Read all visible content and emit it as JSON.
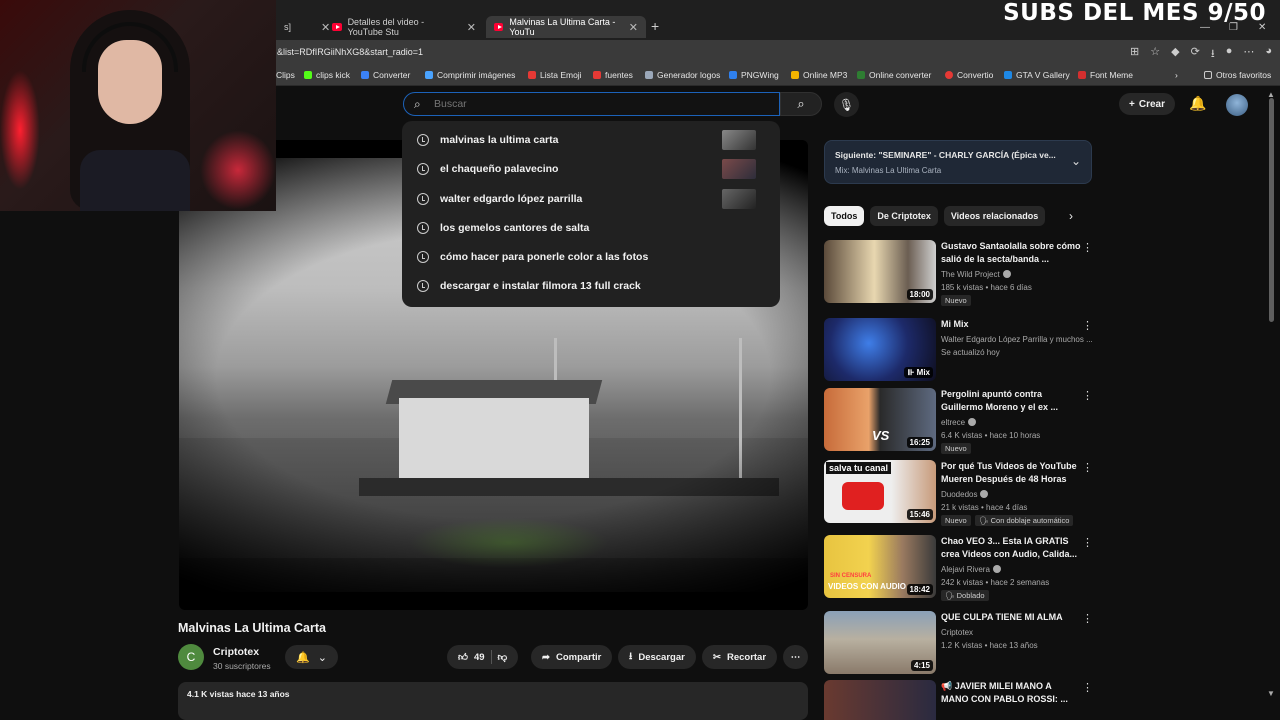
{
  "overlay": {
    "subs_text": "SUBS DEL MES 9/50"
  },
  "browser": {
    "tabs": [
      {
        "label": "s]",
        "active": false
      },
      {
        "label": "Detalles del video - YouTube Stu",
        "active": false
      },
      {
        "label": "Malvinas La Ultima Carta - YouTu",
        "active": true
      }
    ],
    "url": "&list=RDfIRGiiNhXG8&start_radio=1",
    "bookmarks": [
      {
        "label": "Clips",
        "color": "#888888"
      },
      {
        "label": "clips kick",
        "color": "#53fc18"
      },
      {
        "label": "Converter",
        "color": "#3b82f6"
      },
      {
        "label": "Comprimir imágenes",
        "color": "#4aa3ff"
      },
      {
        "label": "Lista Emoji",
        "color": "#e53935"
      },
      {
        "label": "fuentes",
        "color": "#e53935"
      },
      {
        "label": "Generador logos",
        "color": "#9aa7b8"
      },
      {
        "label": "PNGWing",
        "color": "#2f80ed"
      },
      {
        "label": "Online MP3",
        "color": "#f4b400"
      },
      {
        "label": "Online converter",
        "color": "#2e7d32"
      },
      {
        "label": "Convertio",
        "color": "#e53935"
      },
      {
        "label": "GTA V Gallery",
        "color": "#1e88e5"
      },
      {
        "label": "Font Meme",
        "color": "#d32f2f"
      },
      {
        "label": "Otros favoritos",
        "color": "#cccccc"
      }
    ]
  },
  "header": {
    "search_placeholder": "Buscar",
    "create_label": "Crear"
  },
  "suggestions": [
    "malvinas la ultima carta",
    "el chaqueño palavecino",
    "walter edgardo lópez parrilla",
    "los gemelos cantores de salta",
    "cómo hacer para ponerle color a las fotos",
    "descargar e instalar filmora 13 full crack"
  ],
  "video": {
    "title": "Malvinas La Ultima Carta",
    "channel_initial": "C",
    "channel": "Criptotex",
    "subscribers": "30 suscriptores",
    "likes": "49",
    "share_label": "Compartir",
    "download_label": "Descargar",
    "clip_label": "Recortar",
    "views_age": "4.1 K vistas  hace 13 años"
  },
  "next_box": {
    "title": "Siguiente: \"SEMINARE\" - CHARLY GARCÍA (Épica ve...",
    "subtitle": "Mix: Malvinas La Ultima Carta"
  },
  "chips": [
    "Todos",
    "De Criptotex",
    "Videos relacionados"
  ],
  "recommendations": [
    {
      "title": "Gustavo Santaolalla sobre cómo salió de la secta/banda ...",
      "channel": "The Wild Project",
      "verified": true,
      "stats": "185 k vistas • hace 6 días",
      "badge": "Nuevo",
      "duration": "18:00"
    },
    {
      "title": "Mi Mix",
      "channel": "Walter Edgardo López Parrilla y muchos ...",
      "verified": false,
      "stats": "Se actualizó hoy",
      "badge": "",
      "duration": "Mix"
    },
    {
      "title": "Pergolini apuntó contra Guillermo Moreno y el ex ...",
      "channel": "eltrece",
      "verified": true,
      "stats": "6.4 K vistas • hace 10 horas",
      "badge": "Nuevo",
      "duration": "16:25"
    },
    {
      "title": "Por qué Tus Videos de YouTube Mueren Después de 48 Horas",
      "channel": "Duodedos",
      "verified": true,
      "stats": "21 k vistas • hace 4 días",
      "badge": "Nuevo",
      "badge2": "Con doblaje automático",
      "duration": "15:46"
    },
    {
      "title": "Chao VEO 3... Esta IA GRATIS crea Videos con Audio, Calida...",
      "channel": "Alejavi Rivera",
      "verified": true,
      "stats": "242 k vistas • hace 2 semanas",
      "badge": "Doblado",
      "duration": "18:42"
    },
    {
      "title": "QUE CULPA TIENE MI ALMA",
      "channel": "Criptotex",
      "verified": false,
      "stats": "1.2 K vistas • hace 13 años",
      "badge": "",
      "duration": "4:15"
    },
    {
      "title": "JAVIER MILEI MANO A MANO CON PABLO ROSSI: ...",
      "channel": "",
      "verified": false,
      "stats": "",
      "badge": "",
      "duration": ""
    }
  ],
  "thumb_texts": {
    "pergolini": "VS",
    "duodedos": "salva tu canal",
    "veo": "VIDEOS CON AUDIO",
    "veo_small": "SIN CENSURA"
  }
}
